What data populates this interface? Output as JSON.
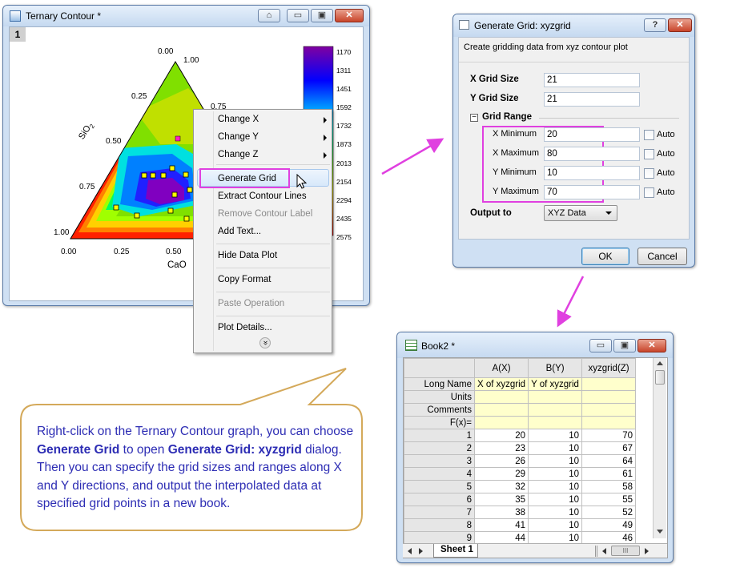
{
  "ternary_window": {
    "title": "Ternary Contour *",
    "layer_label": "1",
    "axis_top_labels": [
      "0.00",
      "0.25",
      "0.50",
      "0.75",
      "1.00"
    ],
    "axis_bottom_labels": [
      "0.00",
      "0.25",
      "0.50"
    ],
    "right_ticks": [
      "1.00",
      "0.75"
    ],
    "sio2_label": "SiO",
    "sio2_sub": "2",
    "cao_label": "CaO",
    "colorbar_labels": [
      "1170",
      "1311",
      "1451",
      "1592",
      "1732",
      "1873",
      "2013",
      "2154",
      "2294",
      "2435",
      "2575"
    ]
  },
  "context_menu": {
    "items": [
      {
        "label": "Change X",
        "submenu": true,
        "disabled": false
      },
      {
        "label": "Change Y",
        "submenu": true,
        "disabled": false
      },
      {
        "label": "Change Z",
        "submenu": true,
        "disabled": false
      },
      {
        "label": "Generate Grid",
        "submenu": false,
        "disabled": false
      },
      {
        "label": "Extract Contour Lines",
        "submenu": false,
        "disabled": false
      },
      {
        "label": "Remove Contour Label",
        "submenu": false,
        "disabled": true
      },
      {
        "label": "Add Text...",
        "submenu": false,
        "disabled": false
      },
      {
        "label": "Hide Data Plot",
        "submenu": false,
        "disabled": false
      },
      {
        "label": "Copy Format",
        "submenu": false,
        "disabled": false
      },
      {
        "label": "Paste Operation",
        "submenu": false,
        "disabled": true
      },
      {
        "label": "Plot Details...",
        "submenu": false,
        "disabled": false
      }
    ],
    "more_glyph": "»"
  },
  "dialog": {
    "title": "Generate Grid: xyzgrid",
    "help_btn": "?",
    "close_btn": "✕",
    "description": "Create gridding data from xyz contour plot",
    "x_grid_size_label": "X Grid Size",
    "x_grid_size": "21",
    "y_grid_size_label": "Y Grid Size",
    "y_grid_size": "21",
    "grid_range_label": "Grid Range",
    "collapse_glyph": "−",
    "x_min_label": "X Minimum",
    "x_min": "20",
    "x_max_label": "X Maximum",
    "x_max": "80",
    "y_min_label": "Y Minimum",
    "y_min": "10",
    "y_max_label": "Y Maximum",
    "y_max": "70",
    "auto_label": "Auto",
    "output_to_label": "Output to",
    "output_to": "XYZ Data",
    "ok": "OK",
    "cancel": "Cancel"
  },
  "book": {
    "title": "Book2 *",
    "columns": [
      "A(X)",
      "B(Y)",
      "xyzgrid(Z)"
    ],
    "long_name_label": "Long Name",
    "long_names": [
      "X of xyzgrid",
      "Y of xyzgrid",
      ""
    ],
    "units_label": "Units",
    "comments_label": "Comments",
    "fx_label": "F(x)=",
    "rows": [
      [
        "1",
        "20",
        "10",
        "70"
      ],
      [
        "2",
        "23",
        "10",
        "67"
      ],
      [
        "3",
        "26",
        "10",
        "64"
      ],
      [
        "4",
        "29",
        "10",
        "61"
      ],
      [
        "5",
        "32",
        "10",
        "58"
      ],
      [
        "6",
        "35",
        "10",
        "55"
      ],
      [
        "7",
        "38",
        "10",
        "52"
      ],
      [
        "8",
        "41",
        "10",
        "49"
      ],
      [
        "9",
        "44",
        "10",
        "46"
      ]
    ],
    "sheet_tab": "Sheet 1",
    "scroll_thumb": "III"
  },
  "callout": {
    "t1": "Right-click on the Ternary Contour graph, you can choose ",
    "b1": "Generate Grid",
    "t2": " to open ",
    "b2": "Generate Grid: xyzgrid",
    "t3": " dialog. Then you can specify the grid sizes and ranges along X and Y directions, and output the interpolated data at specified grid points in a new book."
  },
  "colors": {
    "highlight": "#e040e0",
    "arrow": "#e040e0",
    "callout_border": "#d4a95a",
    "callout_text": "#2d2db4"
  }
}
